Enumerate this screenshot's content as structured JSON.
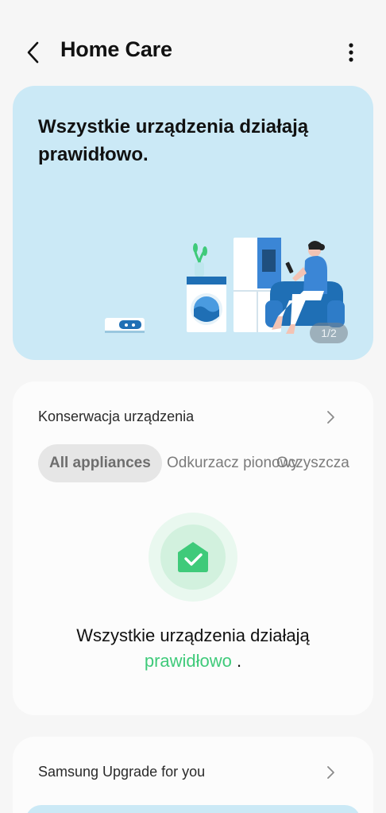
{
  "app_bar": {
    "title": "Home Care",
    "back_icon": "chevron-left-icon",
    "more_icon": "more-vertical-icon"
  },
  "hero": {
    "message": "Wszystkie urządzenia działają prawidłowo.",
    "page_indicator": "1/2",
    "background_color": "#cbe9f6"
  },
  "maintenance": {
    "header": "Konserwacja urządzenia",
    "chips": [
      {
        "label": "All appliances",
        "selected": true
      },
      {
        "label": "Odkurzacz pionowy",
        "selected": false
      },
      {
        "label": "Oczyszczacz S",
        "selected": false
      }
    ],
    "status_prefix": "Wszystkie urządzenia działają",
    "status_highlight": "prawidłowo",
    "status_suffix": " .",
    "accent_color": "#3fca7a"
  },
  "upgrade": {
    "header": "Samsung Upgrade for you"
  }
}
